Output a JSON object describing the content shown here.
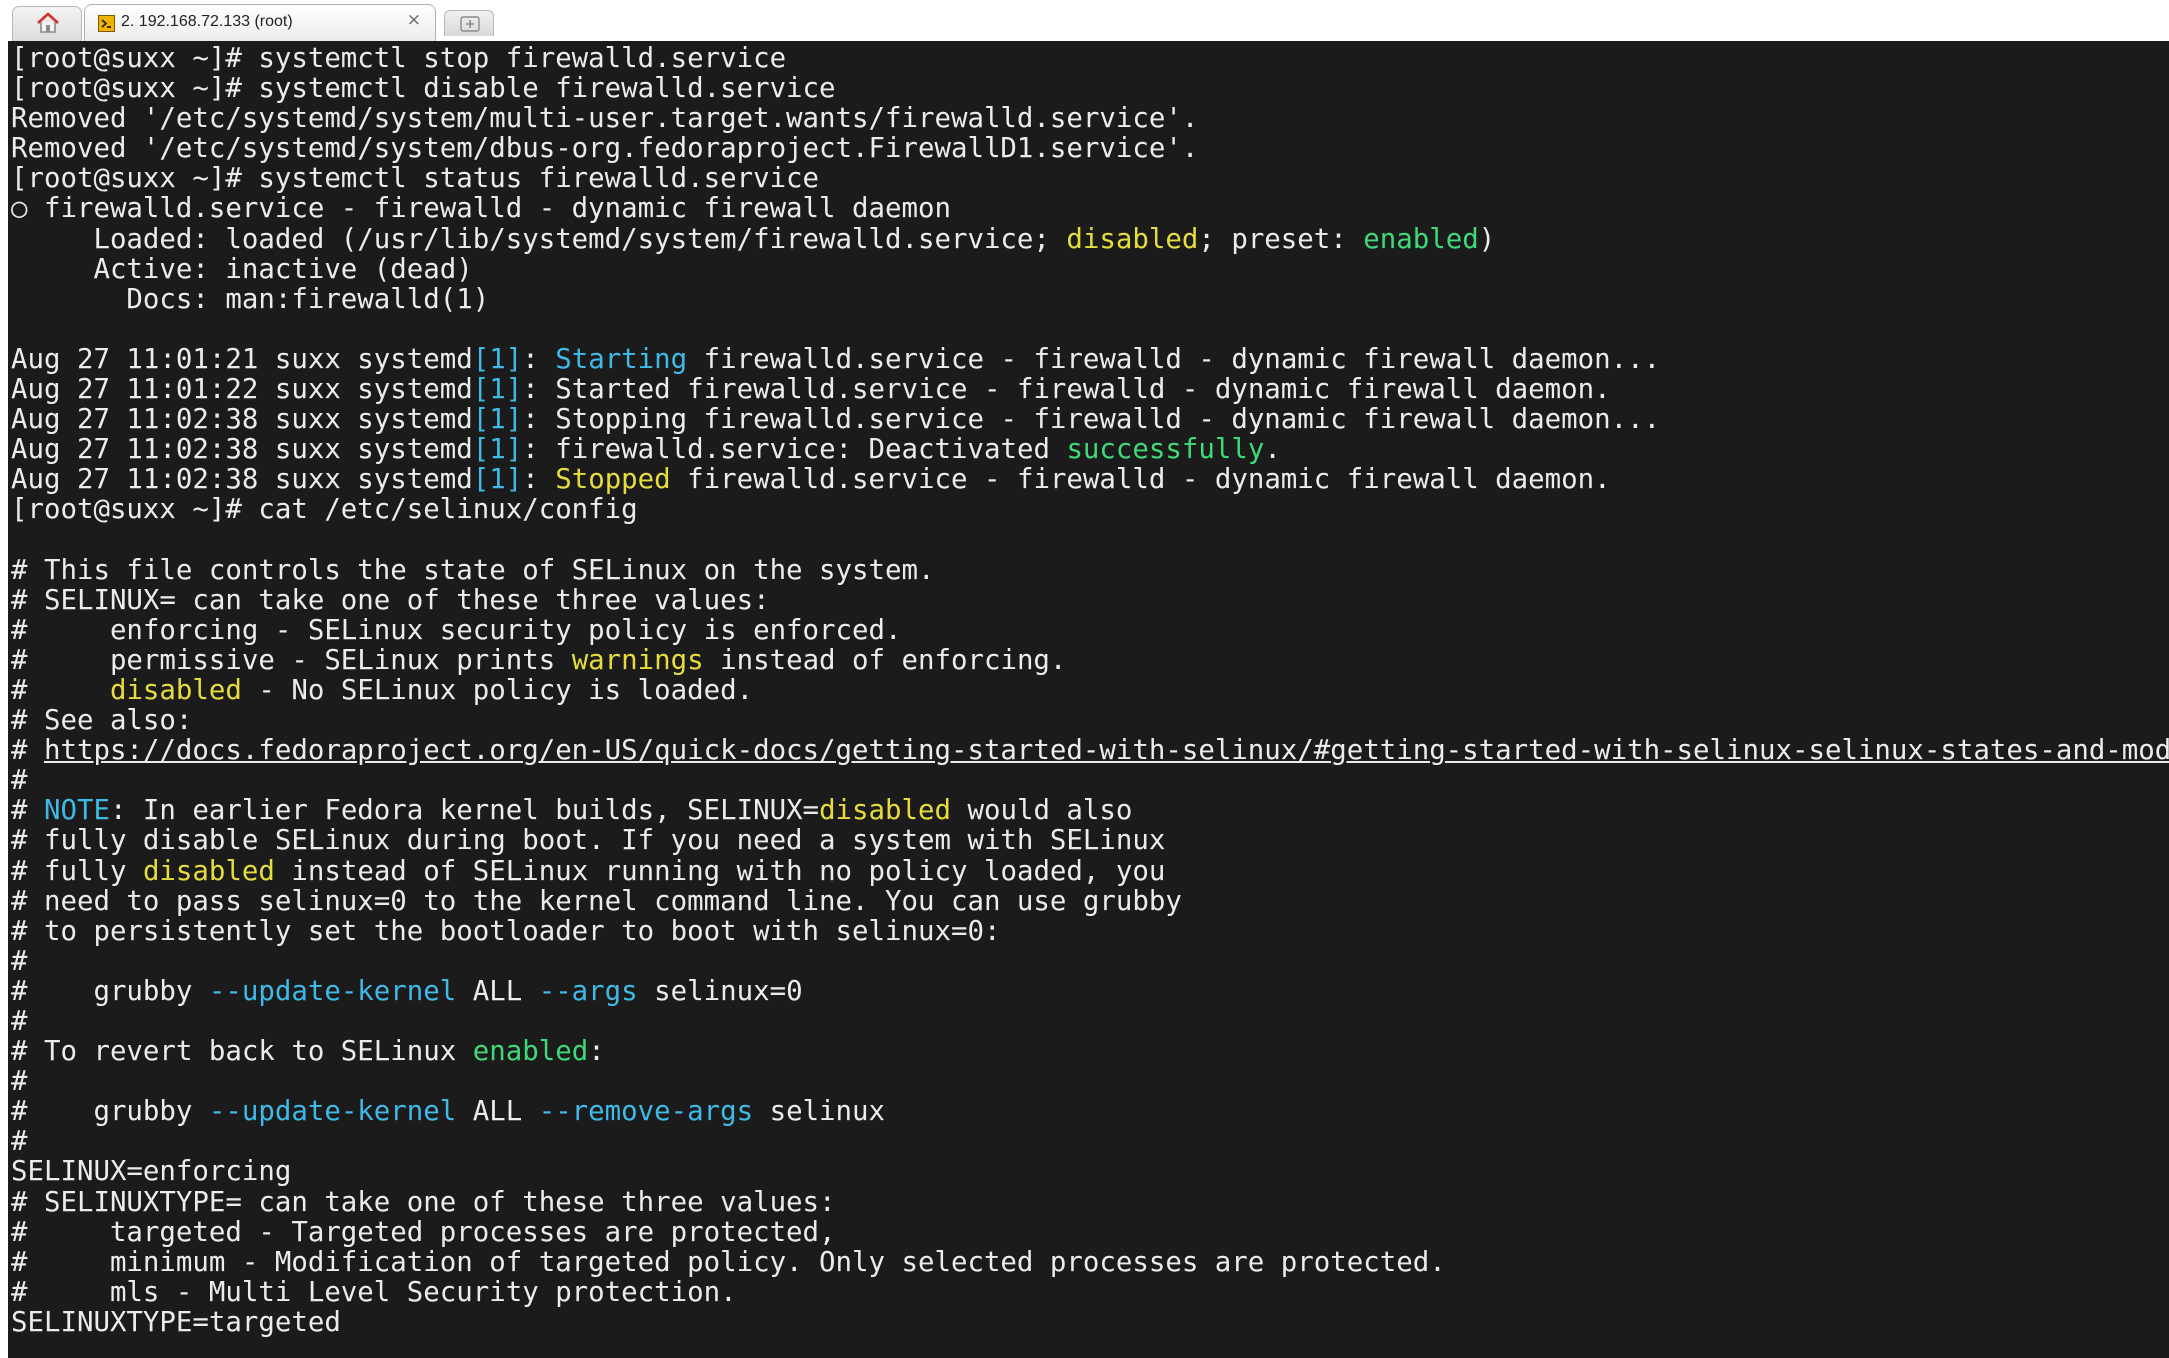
{
  "tabs": {
    "home_icon": "home-icon",
    "active": {
      "title": "2. 192.168.72.133 (root)",
      "icon": "terminal-session-icon",
      "close": "×"
    },
    "new_tab_icon": "add-tab-icon"
  },
  "colors": {
    "background": "#1b1b1b",
    "text": "#ececec",
    "cyan": "#3fb9e6",
    "yellow": "#e6dd3c",
    "green": "#3fd97a"
  },
  "terminal": {
    "lines": [
      [
        {
          "t": "[root@suxx ~]# systemctl stop firewalld.service"
        }
      ],
      [
        {
          "t": "[root@suxx ~]# systemctl disable firewalld.service"
        }
      ],
      [
        {
          "t": "Removed '/etc/systemd/system/multi-user.target.wants/firewalld.service'."
        }
      ],
      [
        {
          "t": "Removed '/etc/systemd/system/dbus-org.fedoraproject.FirewallD1.service'."
        }
      ],
      [
        {
          "t": "[root@suxx ~]# systemctl status firewalld.service"
        }
      ],
      [
        {
          "t": "○ firewalld.service - firewalld - dynamic firewall daemon"
        }
      ],
      [
        {
          "t": "     Loaded: loaded (/usr/lib/systemd/system/firewalld.service; "
        },
        {
          "t": "disabled",
          "c": "yellow"
        },
        {
          "t": "; preset: "
        },
        {
          "t": "enabled",
          "c": "green"
        },
        {
          "t": ")"
        }
      ],
      [
        {
          "t": "     Active: inactive (dead)"
        }
      ],
      [
        {
          "t": "       Docs: man:firewalld(1)"
        }
      ],
      [
        {
          "t": ""
        }
      ],
      [
        {
          "t": "Aug 27 11:01:21 suxx systemd"
        },
        {
          "t": "[1]",
          "c": "cyan"
        },
        {
          "t": ": "
        },
        {
          "t": "Starting",
          "c": "cyan"
        },
        {
          "t": " firewalld.service - firewalld - dynamic firewall daemon..."
        }
      ],
      [
        {
          "t": "Aug 27 11:01:22 suxx systemd"
        },
        {
          "t": "[1]",
          "c": "cyan"
        },
        {
          "t": ": Started firewalld.service - firewalld - dynamic firewall daemon."
        }
      ],
      [
        {
          "t": "Aug 27 11:02:38 suxx systemd"
        },
        {
          "t": "[1]",
          "c": "cyan"
        },
        {
          "t": ": Stopping firewalld.service - firewalld - dynamic firewall daemon..."
        }
      ],
      [
        {
          "t": "Aug 27 11:02:38 suxx systemd"
        },
        {
          "t": "[1]",
          "c": "cyan"
        },
        {
          "t": ": firewalld.service: Deactivated "
        },
        {
          "t": "successfully",
          "c": "green"
        },
        {
          "t": "."
        }
      ],
      [
        {
          "t": "Aug 27 11:02:38 suxx systemd"
        },
        {
          "t": "[1]",
          "c": "cyan"
        },
        {
          "t": ": "
        },
        {
          "t": "Stopped",
          "c": "yellow"
        },
        {
          "t": " firewalld.service - firewalld - dynamic firewall daemon."
        }
      ],
      [
        {
          "t": "[root@suxx ~]# cat /etc/selinux/config"
        }
      ],
      [
        {
          "t": ""
        }
      ],
      [
        {
          "t": "# This file controls the state of SELinux on the system."
        }
      ],
      [
        {
          "t": "# SELINUX= can take one of these three values:"
        }
      ],
      [
        {
          "t": "#     enforcing - SELinux security policy is enforced."
        }
      ],
      [
        {
          "t": "#     permissive - SELinux prints "
        },
        {
          "t": "warnings",
          "c": "yellow"
        },
        {
          "t": " instead of enforcing."
        }
      ],
      [
        {
          "t": "#     "
        },
        {
          "t": "disabled",
          "c": "yellow"
        },
        {
          "t": " - No SELinux policy is loaded."
        }
      ],
      [
        {
          "t": "# See also:"
        }
      ],
      [
        {
          "t": "# "
        },
        {
          "t": "https://docs.fedoraproject.org/en-US/quick-docs/getting-started-with-selinux/#getting-started-with-selinux-selinux-states-and-modes",
          "c": "link"
        }
      ],
      [
        {
          "t": "#"
        }
      ],
      [
        {
          "t": "# "
        },
        {
          "t": "NOTE",
          "c": "cyan"
        },
        {
          "t": ": In earlier Fedora kernel builds, SELINUX="
        },
        {
          "t": "disabled",
          "c": "yellow"
        },
        {
          "t": " would also"
        }
      ],
      [
        {
          "t": "# fully disable SELinux during boot. If you need a system with SELinux"
        }
      ],
      [
        {
          "t": "# fully "
        },
        {
          "t": "disabled",
          "c": "yellow"
        },
        {
          "t": " instead of SELinux running with no policy loaded, you"
        }
      ],
      [
        {
          "t": "# need to pass selinux=0 to the kernel command line. You can use grubby"
        }
      ],
      [
        {
          "t": "# to persistently set the bootloader to boot with selinux=0:"
        }
      ],
      [
        {
          "t": "#"
        }
      ],
      [
        {
          "t": "#    grubby "
        },
        {
          "t": "--update-kernel",
          "c": "cyan"
        },
        {
          "t": " ALL "
        },
        {
          "t": "--args",
          "c": "cyan"
        },
        {
          "t": " selinux=0"
        }
      ],
      [
        {
          "t": "#"
        }
      ],
      [
        {
          "t": "# To revert back to SELinux "
        },
        {
          "t": "enabled",
          "c": "green"
        },
        {
          "t": ":"
        }
      ],
      [
        {
          "t": "#"
        }
      ],
      [
        {
          "t": "#    grubby "
        },
        {
          "t": "--update-kernel",
          "c": "cyan"
        },
        {
          "t": " ALL "
        },
        {
          "t": "--remove-args",
          "c": "cyan"
        },
        {
          "t": " selinux"
        }
      ],
      [
        {
          "t": "#"
        }
      ],
      [
        {
          "t": "SELINUX=enforcing"
        }
      ],
      [
        {
          "t": "# SELINUXTYPE= can take one of these three values:"
        }
      ],
      [
        {
          "t": "#     targeted - Targeted processes are protected,"
        }
      ],
      [
        {
          "t": "#     minimum - Modification of targeted policy. Only selected processes are protected."
        }
      ],
      [
        {
          "t": "#     mls - Multi Level Security protection."
        }
      ],
      [
        {
          "t": "SELINUXTYPE=targeted"
        }
      ]
    ]
  }
}
